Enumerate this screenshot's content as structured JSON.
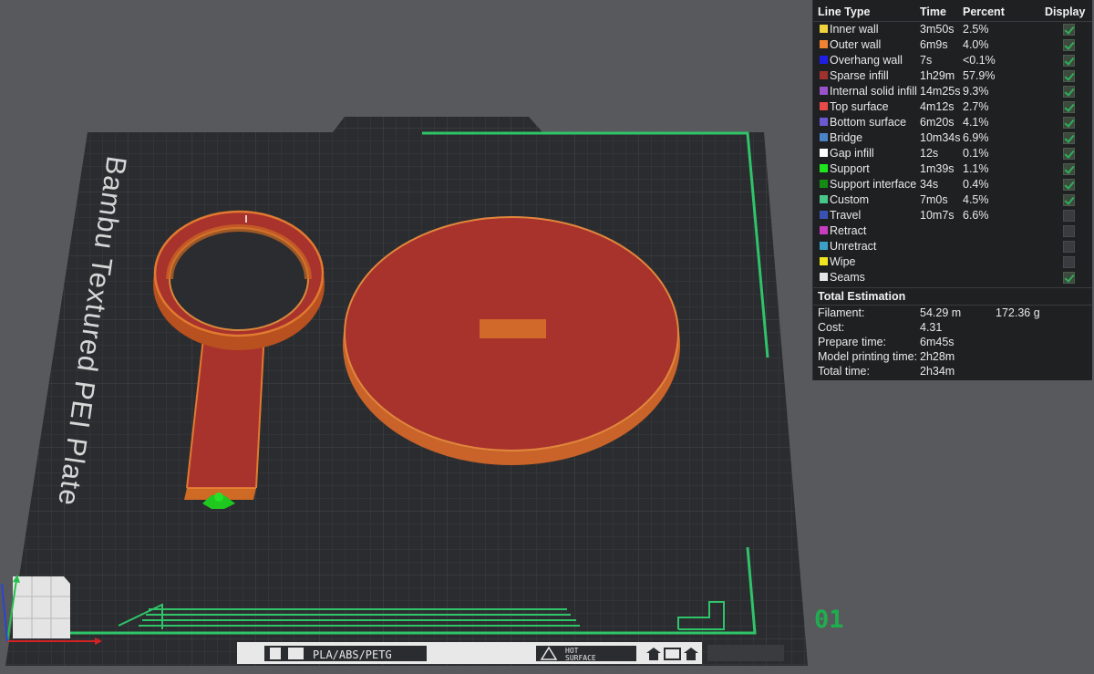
{
  "plate": {
    "label": "Bambu Textured PEI Plate",
    "filament_label": "PLA/ABS/PETG",
    "hot_surface_line1": "HOT",
    "hot_surface_line2": "SURFACE",
    "plate_number": "01"
  },
  "legend": {
    "headers": {
      "line_type": "Line Type",
      "time": "Time",
      "percent": "Percent",
      "display": "Display"
    },
    "rows": [
      {
        "name": "Inner wall",
        "time": "3m50s",
        "percent": "2.5%",
        "color": "#f0d23c",
        "display": true
      },
      {
        "name": "Outer wall",
        "time": "6m9s",
        "percent": "4.0%",
        "color": "#f08232",
        "display": true
      },
      {
        "name": "Overhang wall",
        "time": "7s",
        "percent": "<0.1%",
        "color": "#1e1ee6",
        "display": true
      },
      {
        "name": "Sparse infill",
        "time": "1h29m",
        "percent": "57.9%",
        "color": "#a0322d",
        "display": true
      },
      {
        "name": "Internal solid infill",
        "time": "14m25s",
        "percent": "9.3%",
        "color": "#9a52c8",
        "display": true
      },
      {
        "name": "Top surface",
        "time": "4m12s",
        "percent": "2.7%",
        "color": "#e84a4a",
        "display": true
      },
      {
        "name": "Bottom surface",
        "time": "6m20s",
        "percent": "4.1%",
        "color": "#6a5ad2",
        "display": true
      },
      {
        "name": "Bridge",
        "time": "10m34s",
        "percent": "6.9%",
        "color": "#4a82c6",
        "display": true
      },
      {
        "name": "Gap infill",
        "time": "12s",
        "percent": "0.1%",
        "color": "#ffffff",
        "display": true
      },
      {
        "name": "Support",
        "time": "1m39s",
        "percent": "1.1%",
        "color": "#1ee61e",
        "display": true
      },
      {
        "name": "Support interface",
        "time": "34s",
        "percent": "0.4%",
        "color": "#148c14",
        "display": true
      },
      {
        "name": "Custom",
        "time": "7m0s",
        "percent": "4.5%",
        "color": "#48c68a",
        "display": true
      },
      {
        "name": "Travel",
        "time": "10m7s",
        "percent": "6.6%",
        "color": "#3a52b4",
        "display": false
      },
      {
        "name": "Retract",
        "time": "",
        "percent": "",
        "color": "#c83cc0",
        "display": false
      },
      {
        "name": "Unretract",
        "time": "",
        "percent": "",
        "color": "#3aa0c8",
        "display": false
      },
      {
        "name": "Wipe",
        "time": "",
        "percent": "",
        "color": "#f0e61e",
        "display": false
      },
      {
        "name": "Seams",
        "time": "",
        "percent": "",
        "color": "#e6e6e6",
        "display": true
      }
    ]
  },
  "estimation": {
    "title": "Total Estimation",
    "filament_label": "Filament:",
    "filament_length": "54.29 m",
    "filament_weight": "172.36 g",
    "cost_label": "Cost:",
    "cost_value": "4.31",
    "prepare_label": "Prepare time:",
    "prepare_value": "6m45s",
    "model_label": "Model printing time:",
    "model_value": "2h28m",
    "total_label": "Total time:",
    "total_value": "2h34m"
  },
  "colors": {
    "plate": "#2b2c2f",
    "accent_green": "#2fc46a",
    "object_red": "#a8322c",
    "object_orange": "#cf6a24"
  }
}
